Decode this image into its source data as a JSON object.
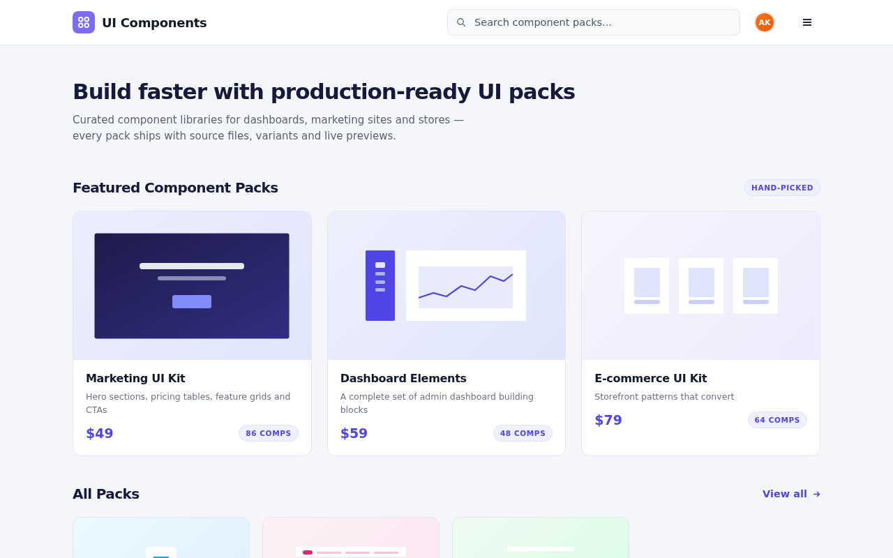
{
  "header": {
    "brand": "UI Components",
    "search": {
      "placeholder": "Search component packs..."
    },
    "avatar": "AK"
  },
  "hero": {
    "title": "Build faster with production-ready UI packs",
    "subtitle": "Curated component libraries for dashboards, marketing sites and stores —\nevery pack ships with source files, variants and live previews."
  },
  "featured": {
    "title": "Featured Component Packs",
    "badge": "HAND-PICKED",
    "cards": [
      {
        "kind": "hero",
        "name": "Marketing UI Kit",
        "description": "Hero sections, pricing tables, feature grids and CTAs",
        "price": "$49",
        "count": "86 COMPS"
      },
      {
        "kind": "dashboard",
        "name": "Dashboard Elements",
        "description": "A complete set of admin dashboard building blocks",
        "price": "$59",
        "count": "48 COMPS"
      },
      {
        "kind": "shop",
        "name": "E-commerce UI Kit",
        "description": "Storefront patterns that convert",
        "price": "$79",
        "count": "64 COMPS"
      }
    ]
  },
  "all_packs": {
    "title": "All Packs",
    "link": "View all",
    "cards": [
      {
        "kind": "mobile"
      },
      {
        "kind": "tabs"
      },
      {
        "kind": "form"
      }
    ]
  }
}
